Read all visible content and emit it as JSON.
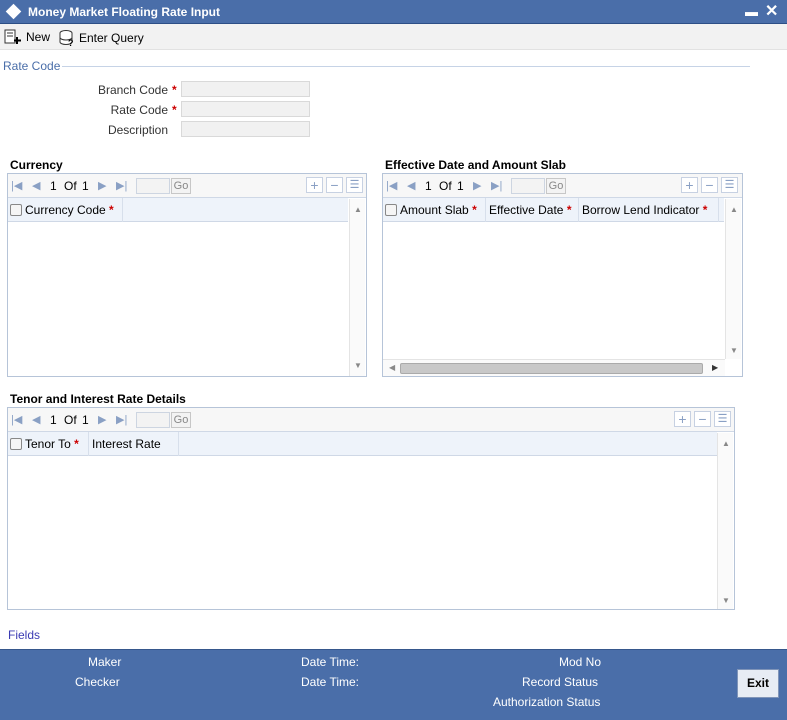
{
  "window": {
    "title": "Money Market Floating Rate Input"
  },
  "toolbar": {
    "new_label": "New",
    "enter_query_label": "Enter Query"
  },
  "rate_code_section": {
    "title": "Rate Code",
    "branch_code_label": "Branch Code",
    "rate_code_label": "Rate Code",
    "description_label": "Description",
    "branch_code_value": "",
    "rate_code_value": "",
    "description_value": ""
  },
  "required_marker": "*",
  "currency": {
    "title": "Currency",
    "page_current": "1",
    "page_of": "Of",
    "page_total": "1",
    "go_label": "Go",
    "columns": [
      {
        "label": "Currency Code",
        "required": true
      }
    ]
  },
  "effective": {
    "title": "Effective Date and Amount Slab",
    "page_current": "1",
    "page_of": "Of",
    "page_total": "1",
    "go_label": "Go",
    "columns": [
      {
        "label": "Amount Slab",
        "required": true
      },
      {
        "label": "Effective Date",
        "required": true
      },
      {
        "label": "Borrow Lend Indicator",
        "required": true
      }
    ]
  },
  "tenor": {
    "title": "Tenor and Interest Rate Details",
    "page_current": "1",
    "page_of": "Of",
    "page_total": "1",
    "go_label": "Go",
    "columns": [
      {
        "label": "Tenor To",
        "required": true
      },
      {
        "label": "Interest Rate",
        "required": false
      }
    ]
  },
  "footer": {
    "fields_link": "Fields",
    "maker_label": "Maker",
    "checker_label": "Checker",
    "date_time_label": "Date Time:",
    "mod_no_label": "Mod No",
    "record_status_label": "Record Status",
    "authorization_status_label": "Authorization Status",
    "exit_label": "Exit"
  },
  "colors": {
    "brand": "#4a6ea9",
    "required": "#cc0000",
    "link": "#3b3bb3"
  }
}
